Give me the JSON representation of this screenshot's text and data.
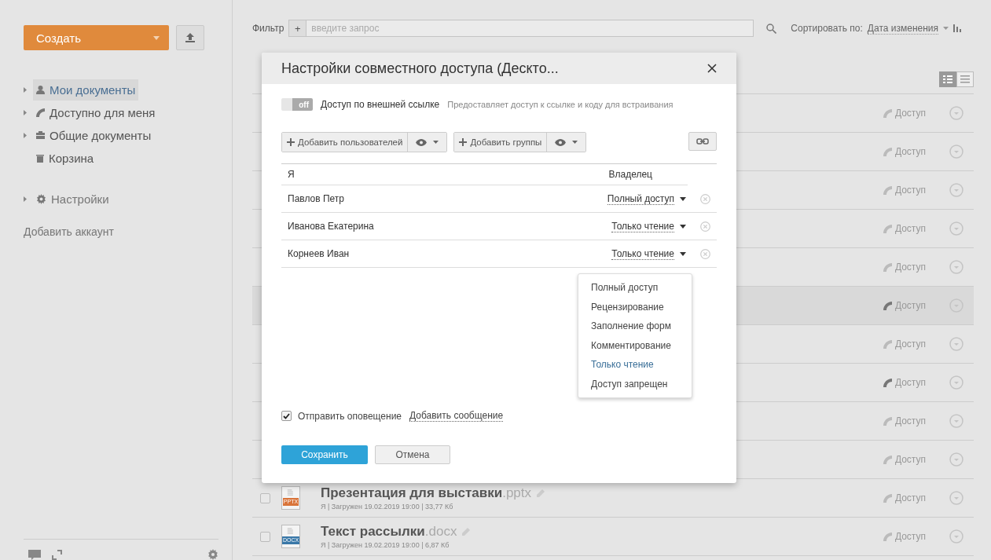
{
  "sidebar": {
    "create_button": "Создать",
    "items": [
      {
        "label": "Мои документы",
        "expander": true,
        "selected": true
      },
      {
        "label": "Доступно для меня",
        "expander": true,
        "selected": false
      },
      {
        "label": "Общие документы",
        "expander": true,
        "selected": false
      },
      {
        "label": "Корзина",
        "expander": false,
        "selected": false
      }
    ],
    "settings": {
      "label": "Настройки",
      "expander": true
    },
    "add_account": "Добавить аккаунт"
  },
  "filter": {
    "label": "Фильтр",
    "add": "+",
    "placeholder": "введите запрос"
  },
  "sort": {
    "label": "Сортировать по:",
    "value": "Дата изменения"
  },
  "files": [
    {
      "share": "Доступ",
      "shared": false,
      "selected": false
    },
    {
      "share": "Доступ",
      "shared": false,
      "selected": false
    },
    {
      "share": "Доступ",
      "shared": false,
      "selected": false
    },
    {
      "share": "Доступ",
      "shared": false,
      "selected": false
    },
    {
      "share": "Доступ",
      "shared": false,
      "selected": false
    },
    {
      "share": "Доступ",
      "shared": true,
      "selected": true
    },
    {
      "share": "Доступ",
      "shared": false,
      "selected": false
    },
    {
      "share": "Доступ",
      "shared": true,
      "selected": false
    },
    {
      "share": "Доступ",
      "shared": false,
      "selected": false
    },
    {
      "share": "Доступ",
      "shared": false,
      "selected": false
    },
    {
      "share": "Доступ",
      "shared": false,
      "selected": false,
      "title": "Презентация для выставки",
      "ext": ".pptx",
      "type": "PPTX",
      "meta": "Я | Загружен 19.02.2019 19:00 | 33,77 Кб"
    },
    {
      "share": "Доступ",
      "shared": false,
      "selected": false,
      "title": "Текст рассылки",
      "ext": ".docx",
      "type": "DOCX",
      "meta": "Я | Загружен 19.02.2019 19:00 | 6,87 Кб"
    }
  ],
  "dialog": {
    "title": "Настройки совместного доступа (Дескто...",
    "external_link": {
      "toggle": "off",
      "on": false,
      "label": "Доступ по внешней ссылке",
      "hint": "Предоставляет доступ к ссылке и коду для встраивания"
    },
    "add_users": "Добавить пользователей",
    "add_groups": "Добавить группы",
    "members": [
      {
        "kind": "owner",
        "name": "Я",
        "rights": "Владелец"
      },
      {
        "kind": "user",
        "name": "Павлов Петр",
        "rights": "Полный доступ"
      },
      {
        "kind": "user",
        "name": "Иванова Екатерина",
        "rights": "Только чтение"
      },
      {
        "kind": "user",
        "name": "Корнеев Иван",
        "rights": "Только чтение"
      }
    ],
    "rights_menu": [
      {
        "label": "Полный доступ",
        "selected": false
      },
      {
        "label": "Рецензирование",
        "selected": false
      },
      {
        "label": "Заполнение форм",
        "selected": false
      },
      {
        "label": "Комментирование",
        "selected": false
      },
      {
        "label": "Только чтение",
        "selected": true
      },
      {
        "label": "Доступ запрещен",
        "selected": false
      }
    ],
    "notify": {
      "label": "Отправить оповещение",
      "checked": true,
      "link": "Добавить сообщение"
    },
    "save": "Сохранить",
    "cancel": "Отмена"
  }
}
